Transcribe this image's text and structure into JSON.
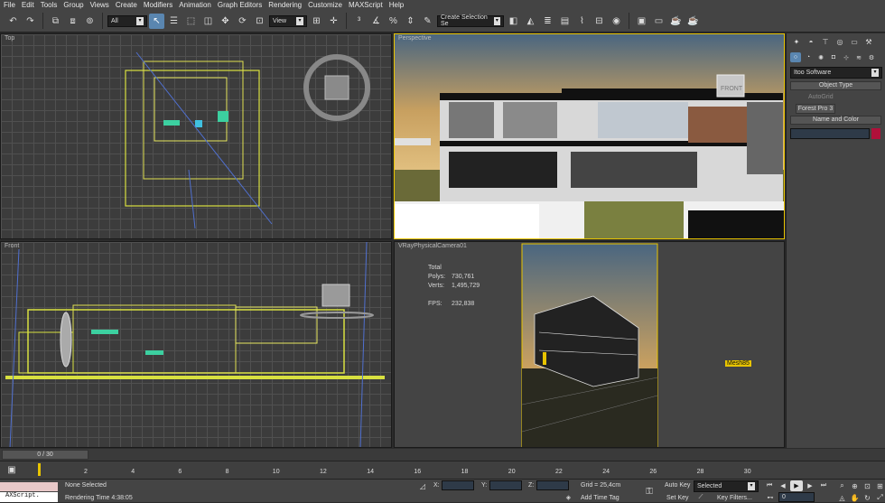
{
  "menu": [
    "File",
    "Edit",
    "Tools",
    "Group",
    "Views",
    "Create",
    "Modifiers",
    "Animation",
    "Graph Editors",
    "Rendering",
    "Customize",
    "MAXScript",
    "Help"
  ],
  "toolbar": {
    "filter": "All",
    "refcoord": "View",
    "selset": "Create Selection Se"
  },
  "viewports": {
    "top": "Top",
    "persp": "Perspective",
    "front": "Front",
    "cam": "VRayPhysicalCamera01"
  },
  "stats": {
    "total": "Total",
    "polys_label": "Polys:",
    "polys": "730,761",
    "verts_label": "Verts:",
    "verts": "1,495,729",
    "fps_label": "FPS:",
    "fps": "232,838"
  },
  "cube_label": "FRONT",
  "mesh_tag": "Mesh85",
  "cmd": {
    "category": "Itoo Software",
    "object_type": "Object Type",
    "autogrid": "AutoGrid",
    "forest": "Forest Pro 3",
    "name_color": "Name and Color"
  },
  "time": {
    "frame": "0 / 30",
    "ticks": [
      "2",
      "4",
      "6",
      "8",
      "10",
      "12",
      "14",
      "16",
      "18",
      "20",
      "22",
      "24",
      "26",
      "28",
      "30"
    ]
  },
  "status": {
    "script": "AXScript.",
    "selection": "None Selected",
    "render": "Rendering Time  4:38:05",
    "x": "X:",
    "y": "Y:",
    "z": "Z:",
    "grid": "Grid = 25,4cm",
    "addtime": "Add Time Tag",
    "autokey": "Auto Key",
    "setkey": "Set Key",
    "selected": "Selected",
    "keyfilters": "Key Filters...",
    "frame_val": "0"
  },
  "colors": {
    "accent": "#5a86b0",
    "selection": "#e8c400",
    "swatch": "#b0103a"
  }
}
